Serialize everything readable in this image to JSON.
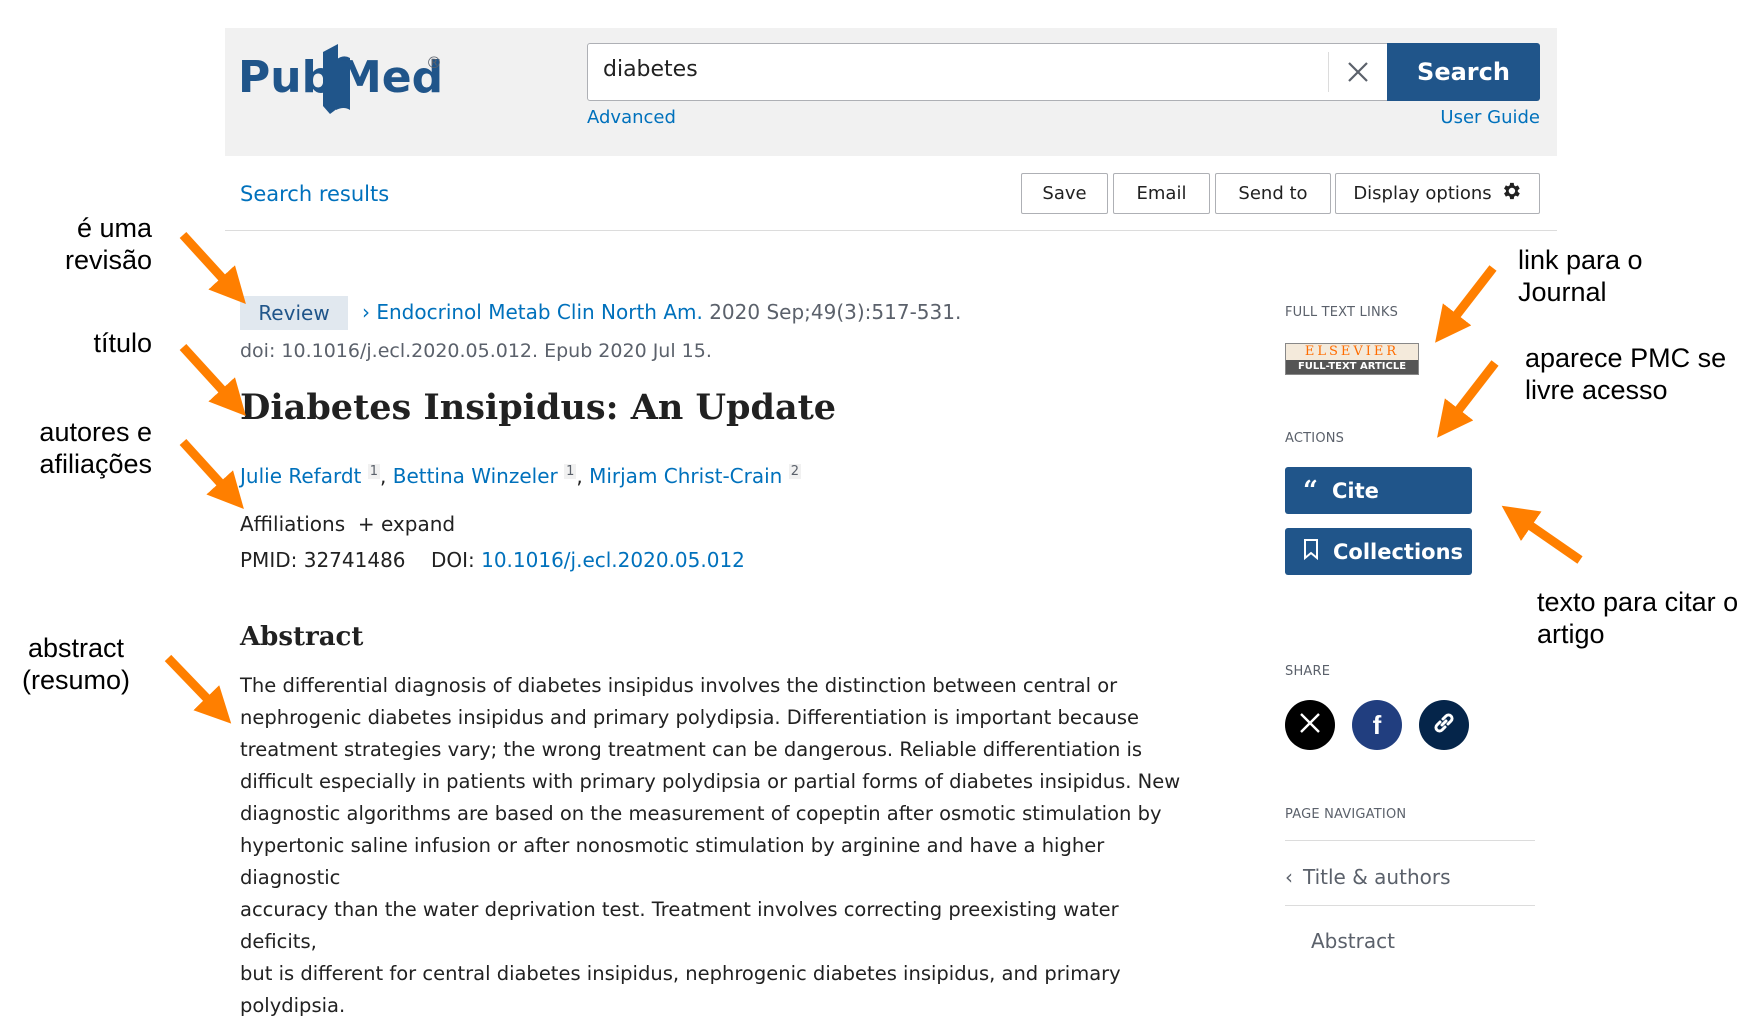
{
  "header": {
    "logo_text": "PubMed",
    "search_value": "diabetes",
    "search_button_label": "Search",
    "advanced_label": "Advanced",
    "user_guide_label": "User Guide"
  },
  "toolbar": {
    "search_results_label": "Search results",
    "save_label": "Save",
    "email_label": "Email",
    "send_to_label": "Send to",
    "display_options_label": "Display options"
  },
  "article": {
    "type_badge": "Review",
    "journal": "Endocrinol Metab Clin North Am.",
    "citation": "2020 Sep;49(3):517-531.",
    "doi_epub": "doi: 10.1016/j.ecl.2020.05.012. Epub 2020 Jul 15.",
    "title": "Diabetes Insipidus: An Update",
    "authors": [
      {
        "name": "Julie Refardt",
        "aff": "1"
      },
      {
        "name": "Bettina Winzeler",
        "aff": "1"
      },
      {
        "name": "Mirjam Christ-Crain",
        "aff": "2"
      }
    ],
    "affiliations_label": "Affiliations",
    "expand_label": "expand",
    "pmid_label": "PMID:",
    "pmid_value": "32741486",
    "doi_label": "DOI:",
    "doi_value": "10.1016/j.ecl.2020.05.012",
    "abstract_heading": "Abstract",
    "abstract_lines": [
      "The differential diagnosis of diabetes insipidus involves the distinction between central or",
      "nephrogenic diabetes insipidus and primary polydipsia. Differentiation is important because",
      "treatment strategies vary; the wrong treatment can be dangerous. Reliable differentiation is",
      "difficult especially in patients with primary polydipsia or partial forms of diabetes insipidus. New",
      "diagnostic algorithms are based on the measurement of copeptin after osmotic stimulation by",
      "hypertonic saline infusion or after nonosmotic stimulation by arginine and have a higher diagnostic",
      "accuracy than the water deprivation test. Treatment involves correcting preexisting water deficits,",
      "but is different for central diabetes insipidus, nephrogenic diabetes insipidus, and primary",
      "polydipsia."
    ]
  },
  "sidebar": {
    "full_text_links_label": "FULL TEXT LINKS",
    "elsevier_top": "ELSEVIER",
    "elsevier_bottom": "FULL-TEXT ARTICLE",
    "actions_label": "ACTIONS",
    "cite_label": "Cite",
    "collections_label": "Collections",
    "share_label": "SHARE",
    "page_navigation_label": "PAGE NAVIGATION",
    "nav_items": [
      "Title & authors",
      "Abstract"
    ]
  },
  "annotations": {
    "review": "é uma\nrevisão",
    "title": "título",
    "authors": "autores e\nafiliações",
    "abstract": "abstract\n(resumo)",
    "journal_link": "link para o\nJournal",
    "pmc": "aparece PMC se\nlivre acesso",
    "cite": "texto para citar o\nartigo"
  },
  "colors": {
    "brand_blue": "#20558a",
    "link_blue": "#0071bc",
    "arrow_orange": "#ff7f00",
    "header_grey": "#f1f1f1"
  },
  "icons": [
    "clear-icon",
    "gear-icon",
    "chevron-right-icon",
    "quote-icon",
    "bookmark-icon",
    "x-logo-icon",
    "facebook-icon",
    "link-icon",
    "chevron-left-icon"
  ]
}
